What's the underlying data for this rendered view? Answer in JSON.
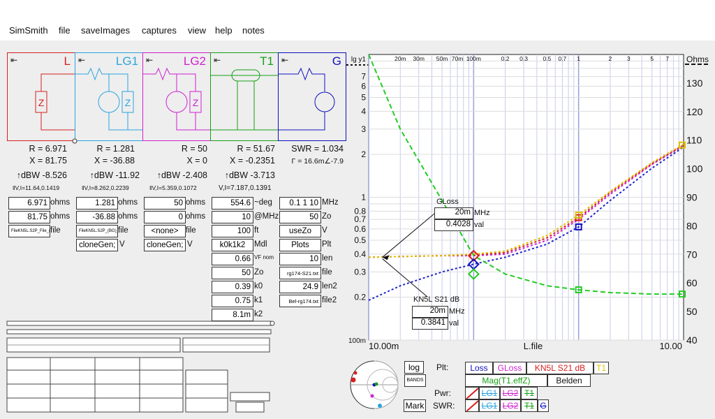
{
  "menu": [
    "SimSmith",
    "file",
    "saveImages",
    "captures",
    "view",
    "help",
    "notes"
  ],
  "cards": [
    {
      "label": "L",
      "color": "#d62020",
      "stats": {
        "r": "R = 6.971",
        "x": "X = 81.75",
        "dbw": "↑dBW -8.526",
        "vi": "‖V,I=11.64,0.1419"
      }
    },
    {
      "label": "LG1",
      "color": "#2aa4e0",
      "stats": {
        "r": "R = 1.281",
        "x": "X = -36.88",
        "dbw": "↑dBW -11.92",
        "vi": "‖V,I=8.262,0.2239"
      }
    },
    {
      "label": "LG2",
      "color": "#d020d0",
      "stats": {
        "r": "R = 50",
        "x": "X = 0",
        "dbw": "↑dBW -2.408",
        "vi": "‖V,I=5.359,0.1072"
      }
    },
    {
      "label": "T1",
      "color": "#16a016",
      "stats": {
        "r": "R = 51.67",
        "x": "X = -0.2351",
        "dbw": "↑dBW -3.713",
        "vi": "V,I=7.187,0.1391"
      }
    },
    {
      "label": "G",
      "color": "#1010c0",
      "stats": {
        "swr": "SWR = 1.034",
        "gamma": "Γ = 16.6m∠-7.9"
      }
    }
  ],
  "inputs": {
    "L": {
      "v1": "6.971",
      "u1": "ohms",
      "v2": "81.75",
      "u2": "ohms",
      "v3": "FileKN5L.S2P_File_(BG)_(Beldenryg)",
      "u3": "file"
    },
    "LG1": {
      "v1": "1.281",
      "u1": "ohms",
      "v2": "-36.88",
      "u2": "ohms",
      "v3": "FileKN5L.S2P_(BG)_(Beldenryg)",
      "u3": "file",
      "v4": "cloneGen;",
      "u4": "V"
    },
    "LG2": {
      "v1": "50",
      "u1": "ohms",
      "v2": "0",
      "u2": "ohms",
      "v3": "<none>",
      "u3": "file",
      "v4": "cloneGen;",
      "u4": "V"
    },
    "T1": [
      {
        "v": "554.6",
        "u": "~deg"
      },
      {
        "v": "10",
        "u": "@MHz"
      },
      {
        "v": "100",
        "u": "ft"
      },
      {
        "v": "k0k1k2",
        "u": "Mdl"
      },
      {
        "v": "0.66",
        "u": "VF nom"
      },
      {
        "v": "50",
        "u": "Zo"
      },
      {
        "v": "0.39",
        "u": "k0"
      },
      {
        "v": "0.75",
        "u": "k1"
      },
      {
        "v": "8.1m",
        "u": "k2"
      }
    ],
    "G": [
      {
        "v": "0.1 1 10",
        "u": "MHz"
      },
      {
        "v": "50",
        "u": "Zo"
      },
      {
        "v": "useZo",
        "u": "V"
      },
      {
        "v": "Plots",
        "u": "Plt"
      },
      {
        "v": "10",
        "u": "len"
      },
      {
        "v": "rg174-S21.txt",
        "u": "file"
      },
      {
        "v": "24.9",
        "u": "len2"
      },
      {
        "v": "Bel-rg174.txt",
        "u": "file2"
      }
    ]
  },
  "chart_data": {
    "type": "line",
    "x_scale": "log",
    "xlim": [
      0.01,
      10
    ],
    "y_left_scale": "log",
    "ylim_left": [
      0.1,
      10
    ],
    "ylim_right": [
      40,
      140
    ],
    "top_ticks": [
      "20m",
      "30m",
      "50m",
      "70m",
      "100m",
      "0.2",
      "0.3",
      "0.5",
      "0.7",
      "1",
      "2",
      "3",
      "5",
      "7"
    ],
    "left_ticks": [
      "lg y1",
      "7",
      "6",
      "5",
      "4",
      "3",
      "2",
      "1",
      "0.8",
      "0.7",
      "0.6",
      "0.5",
      "0.4",
      "0.3",
      "0.2",
      "100m"
    ],
    "right_ticks": [
      "Ohms",
      "130",
      "120",
      "110",
      "100",
      "90",
      "80",
      "70",
      "60",
      "50",
      "40"
    ],
    "x_label": "L.file",
    "x_min_label": "10.00m",
    "x_max_label": "10.00",
    "markers": [
      {
        "name": "GLoss",
        "freq": "20m",
        "freq_unit": "MHz",
        "value": "0.4028",
        "value_unit": "val"
      },
      {
        "name": "KN5L S21 dB",
        "freq": "20m",
        "freq_unit": "MHz",
        "value": "0.3841",
        "value_unit": "val"
      }
    ],
    "series": [
      {
        "name": "Loss",
        "color": "#2222cc",
        "x": [
          0.01,
          0.02,
          0.05,
          0.1,
          0.2,
          0.5,
          1,
          2,
          5,
          10
        ],
        "y": [
          0.19,
          0.24,
          0.3,
          0.34,
          0.38,
          0.47,
          0.62,
          0.95,
          1.6,
          2.25
        ]
      },
      {
        "name": "GLoss",
        "color": "#d020d0",
        "x": [
          0.01,
          0.02,
          0.05,
          0.1,
          0.2,
          0.5,
          1,
          2,
          5,
          10
        ],
        "y": [
          0.38,
          0.385,
          0.39,
          0.39,
          0.4,
          0.5,
          0.7,
          1.05,
          1.7,
          2.3
        ]
      },
      {
        "name": "KN5L S21 dB",
        "color": "#d62020",
        "x": [
          0.01,
          0.02,
          0.05,
          0.1,
          0.2,
          0.5,
          1,
          2,
          5,
          10
        ],
        "y": [
          0.38,
          0.385,
          0.39,
          0.395,
          0.41,
          0.52,
          0.72,
          1.08,
          1.72,
          2.32
        ]
      },
      {
        "name": "T1",
        "color": "#e0c000",
        "x": [
          0.01,
          0.02,
          0.05,
          0.1,
          0.2,
          0.5,
          1,
          2,
          5,
          10
        ],
        "y": [
          0.38,
          0.385,
          0.39,
          0.4,
          0.42,
          0.54,
          0.75,
          1.1,
          1.75,
          2.35
        ]
      },
      {
        "name": "Mag(T1.effZ)",
        "color": "#22cc22",
        "x": [
          0.01,
          0.02,
          0.05,
          0.1,
          0.2,
          0.5,
          1,
          2,
          5,
          10
        ],
        "y": [
          10,
          3.0,
          0.95,
          0.39,
          0.29,
          0.24,
          0.225,
          0.215,
          0.21,
          0.21
        ]
      }
    ]
  },
  "controls": {
    "log": "log",
    "bands": "BANDS",
    "mark": "Mark",
    "plt_label": "Plt:",
    "pwr_label": "Pwr:",
    "swr_label": "SWR:",
    "plt_buttons": [
      "Loss",
      "GLoss",
      "KN5L S21 dB",
      "T1"
    ],
    "plt_row2": [
      "Mag(T1.effZ)",
      "Belden"
    ],
    "pwr_buttons": [
      "LG1",
      "LG2",
      "T1"
    ],
    "swr_buttons": [
      "LG1",
      "LG2",
      "T1",
      "G"
    ]
  }
}
